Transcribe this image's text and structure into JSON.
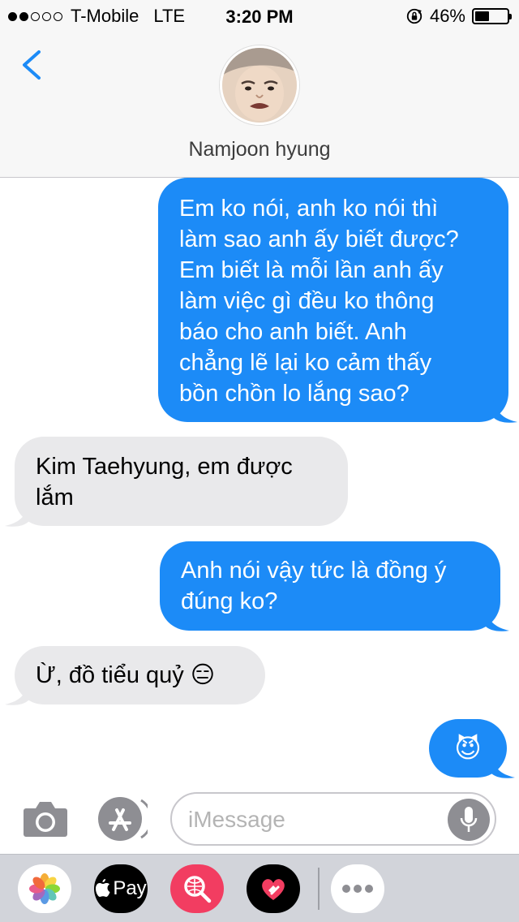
{
  "status_bar": {
    "carrier": "T-Mobile",
    "network": "LTE",
    "time": "3:20 PM",
    "battery_percent": "46%",
    "battery_level": 0.46,
    "signal_bars_filled": 2,
    "signal_bars_total": 5
  },
  "header": {
    "contact_name": "Namjoon hyung",
    "back_icon": "chevron-left-icon"
  },
  "messages": [
    {
      "direction": "outgoing",
      "lines": [
        "Em ko nói, anh ko nói thì",
        "làm sao anh ấy biết được?",
        "Em biết là mỗi lần anh ấy",
        "làm việc gì đều ko thông",
        "báo cho anh biết. Anh",
        "chẳng lẽ lại ko cảm thấy",
        "bồn chồn lo lắng sao?"
      ]
    },
    {
      "direction": "incoming",
      "lines": [
        "Kim Taehyung, em được",
        "lắm"
      ]
    },
    {
      "direction": "outgoing",
      "lines": [
        "Anh nói vậy tức là đồng ý",
        "đúng ko?"
      ]
    },
    {
      "direction": "incoming",
      "lines": [
        "Ừ, đồ tiểu quỷ 😑"
      ]
    },
    {
      "direction": "outgoing",
      "lines": [
        "😈"
      ]
    }
  ],
  "input_bar": {
    "placeholder": "iMessage",
    "value": ""
  },
  "app_drawer": {
    "apple_pay_label": "Pay",
    "apps": [
      "photos-icon",
      "apple-pay-icon",
      "image-search-icon",
      "digital-touch-icon",
      "more-icon"
    ]
  },
  "colors": {
    "outgoing_bubble": "#1c8bf7",
    "incoming_bubble": "#e9e9eb",
    "accent": "#1c8bf7",
    "header_bg": "#f7f7f7",
    "drawer_bg": "#d2d4da"
  }
}
